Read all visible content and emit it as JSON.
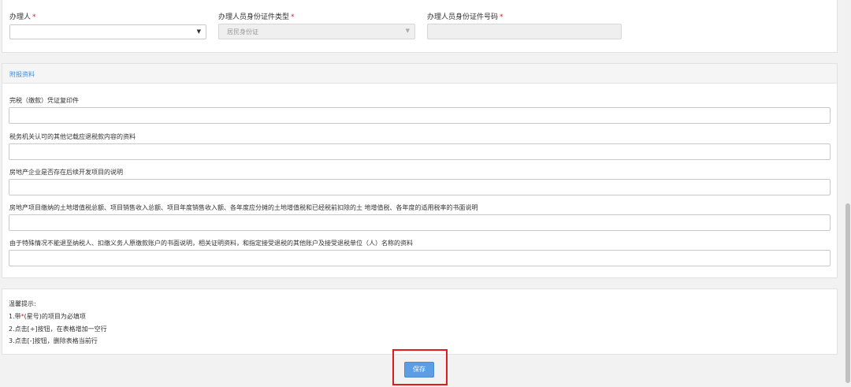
{
  "top_form": {
    "handler_label": "办理人",
    "id_type_label": "办理人员身份证件类型",
    "id_type_value": "居民身份证",
    "id_number_label": "办理人员身份证件号码",
    "required_mark": "*",
    "caret": "▼"
  },
  "attachments": {
    "title": "附报资料",
    "items": [
      {
        "label": "完税（缴款）凭证复印件"
      },
      {
        "label": "税务机关认可的其他记载应退税款内容的资料"
      },
      {
        "label": "房地产企业是否存在后续开发项目的说明"
      },
      {
        "label": "房地产项目缴纳的土地增值税总额、项目销售收入总额、项目年度销售收入额、各年度应分摊的土地增值税和已经税前扣除的土 地增值税、各年度的适用税率的书面说明"
      },
      {
        "label": "由于特殊情况不能退至纳税人、扣缴义务人原缴款账户的书面说明，相关证明资料，和指定接受退税的其他账户及接受退税单位（人）名称的资料"
      }
    ]
  },
  "tips": {
    "title": "温馨提示:",
    "line1_prefix": "1.带",
    "line1_star": "*",
    "line1_suffix": "(星号)的项目为必填项",
    "line2": "2.点击[+]按钮，在表格增加一空行",
    "line3": "3.点击[-]按钮，删除表格当前行"
  },
  "actions": {
    "save_label": "保存"
  },
  "colors": {
    "accent": "#3a8ee6",
    "required": "#e02020",
    "highlight": "#e01b1b",
    "button": "#5b9ee6"
  }
}
